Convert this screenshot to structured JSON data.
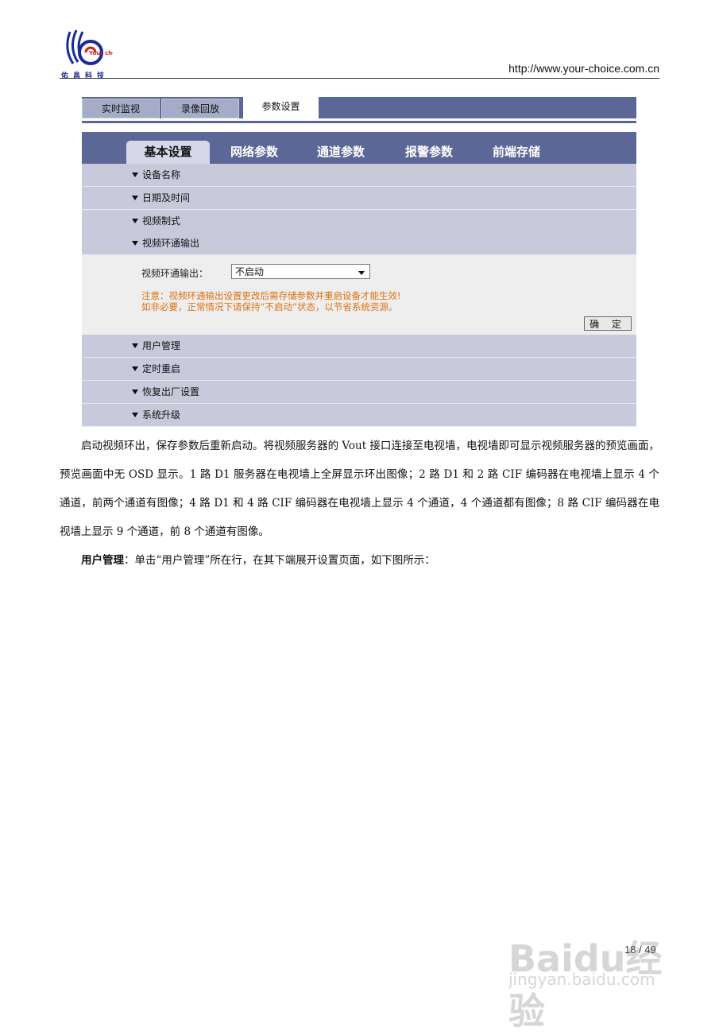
{
  "header": {
    "logo_caption": "佑昌科技",
    "logo_tagline": "Your choice",
    "url": "http://www.your-choice.com.cn"
  },
  "ui": {
    "top_tabs": [
      "实时监视",
      "录像回放",
      "参数设置"
    ],
    "active_top_tab": "参数设置",
    "sub_tabs": [
      "基本设置",
      "网络参数",
      "通道参数",
      "报警参数",
      "前端存储"
    ],
    "active_sub_tab": "基本设置",
    "sections_before": [
      "设备名称",
      "日期及时间",
      "视频制式",
      "视频环通输出"
    ],
    "expanded": {
      "field_label": "视频环通输出：",
      "select_value": "不启动",
      "note_line1": "注意：视频环通输出设置更改后需存储参数并重启设备才能生效!",
      "note_line2": "如非必要，正常情况下请保持“不启动”状态，以节省系统资源。",
      "ok_button": "确 定"
    },
    "sections_after": [
      "用户管理",
      "定时重启",
      "恢复出厂设置",
      "系统升级"
    ]
  },
  "body": {
    "para1": "启动视频环出，保存参数后重新启动。将视频服务器的 Vout 接口连接至电视墙，电视墙即可显示视频服务器的预览画面，预览画面中无 OSD 显示。1 路 D1 服务器在电视墙上全屏显示环出图像；2 路 D1 和 2 路 CIF 编码器在电视墙上显示 4 个通道，前两个通道有图像；4 路 D1 和 4 路 CIF 编码器在电视墙上显示 4 个通道，4 个通道都有图像；8 路 CIF 编码器在电视墙上显示 9 个通道，前 8 个通道有图像。",
    "para2_bold": "用户管理",
    "para2_rest": "：单击“用户管理”所在行，在其下端展开设置页面，如下图所示："
  },
  "footer": {
    "page_number": "18 / 49",
    "watermark_brand": "Baidu经验",
    "watermark_url": "jingyan.baidu.com"
  },
  "colors": {
    "nav_bar": "#5b6796",
    "section_row": "#c9c9dc",
    "note_text": "#e07010"
  }
}
